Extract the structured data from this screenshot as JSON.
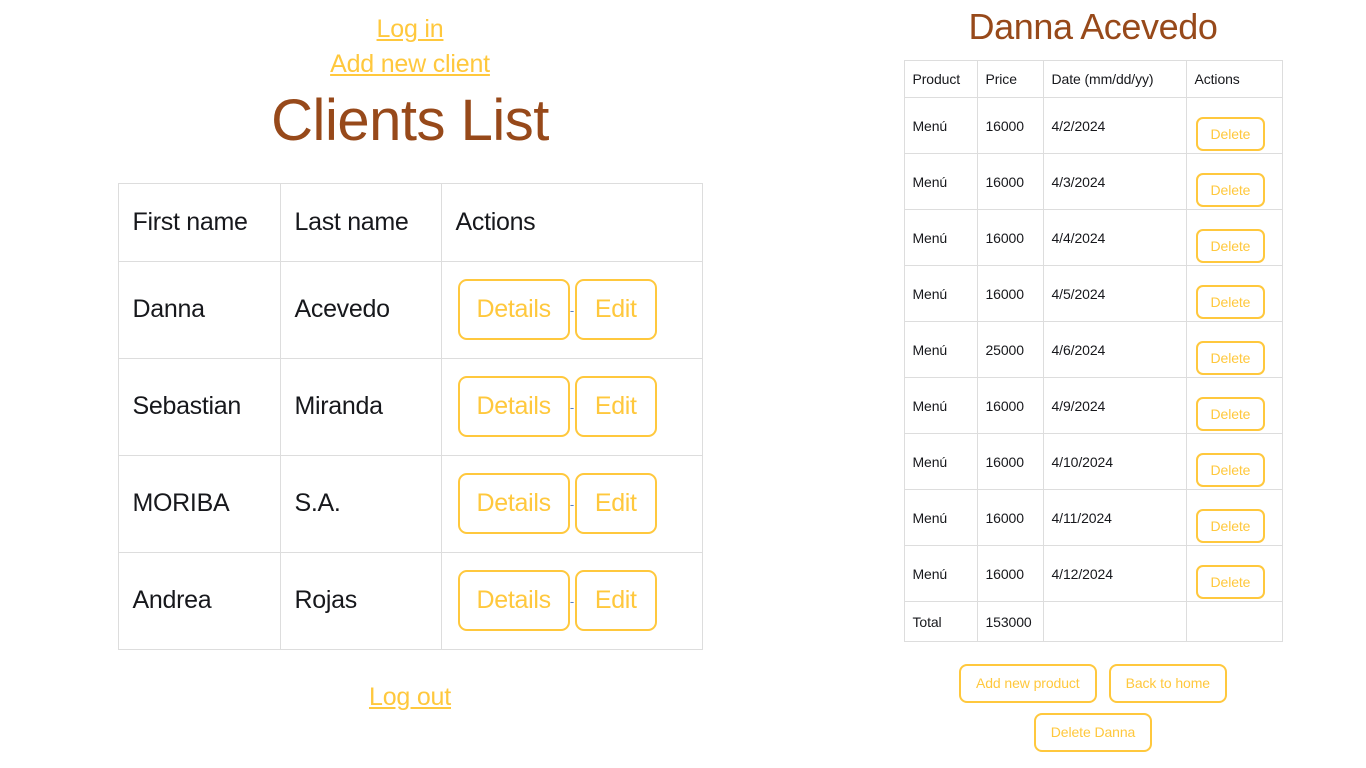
{
  "theme": {
    "accent": "#FFC83D",
    "heading": "#97491A",
    "text": "#17181C",
    "border": "#DDDDDD",
    "background": "#FFFFFF"
  },
  "left": {
    "links": [
      {
        "label": "Log in",
        "name": "log-in-link"
      },
      {
        "label": "Add new client",
        "name": "add-new-client-link"
      }
    ],
    "title": "Clients List",
    "table": {
      "headers": [
        "First name",
        "Last name",
        "Actions"
      ],
      "rows": [
        {
          "first_name": "Danna",
          "last_name": "Acevedo",
          "details_label": "Details",
          "edit_label": "Edit",
          "separator": "-"
        },
        {
          "first_name": "Sebastian",
          "last_name": "Miranda",
          "details_label": "Details",
          "edit_label": "Edit",
          "separator": "-"
        },
        {
          "first_name": "MORIBA",
          "last_name": "S.A.",
          "details_label": "Details",
          "edit_label": "Edit",
          "separator": "-"
        },
        {
          "first_name": "Andrea",
          "last_name": "Rojas",
          "details_label": "Details",
          "edit_label": "Edit",
          "separator": "-"
        }
      ]
    },
    "logout_label": "Log out"
  },
  "right": {
    "client_name": "Danna Acevedo",
    "table": {
      "headers": [
        "Product",
        "Price",
        "Date (mm/dd/yy)",
        "Actions"
      ],
      "rows": [
        {
          "product": "Menú",
          "price": "16000",
          "date": "4/2/2024",
          "delete_label": "Delete"
        },
        {
          "product": "Menú",
          "price": "16000",
          "date": "4/3/2024",
          "delete_label": "Delete"
        },
        {
          "product": "Menú",
          "price": "16000",
          "date": "4/4/2024",
          "delete_label": "Delete"
        },
        {
          "product": "Menú",
          "price": "16000",
          "date": "4/5/2024",
          "delete_label": "Delete"
        },
        {
          "product": "Menú",
          "price": "25000",
          "date": "4/6/2024",
          "delete_label": "Delete"
        },
        {
          "product": "Menú",
          "price": "16000",
          "date": "4/9/2024",
          "delete_label": "Delete"
        },
        {
          "product": "Menú",
          "price": "16000",
          "date": "4/10/2024",
          "delete_label": "Delete"
        },
        {
          "product": "Menú",
          "price": "16000",
          "date": "4/11/2024",
          "delete_label": "Delete"
        },
        {
          "product": "Menú",
          "price": "16000",
          "date": "4/12/2024",
          "delete_label": "Delete"
        }
      ],
      "total": {
        "label": "Total",
        "value": "153000",
        "date": "",
        "actions": ""
      }
    },
    "footer_buttons": [
      {
        "label": "Add new product",
        "name": "add-new-product-button"
      },
      {
        "label": "Back to home",
        "name": "back-to-home-button"
      },
      {
        "label": "Delete Danna",
        "name": "delete-client-button"
      }
    ]
  }
}
